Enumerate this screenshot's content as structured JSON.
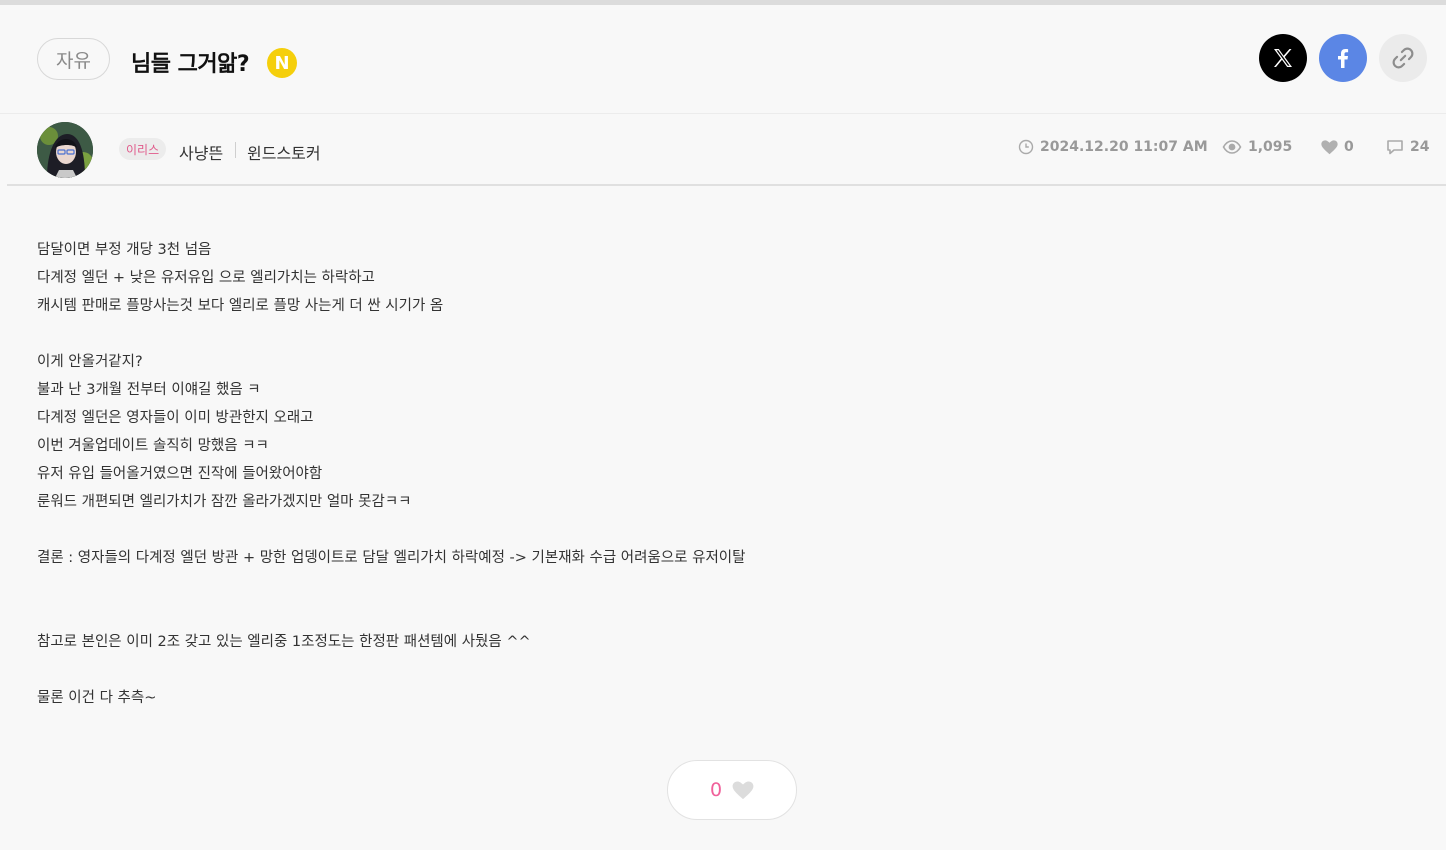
{
  "post": {
    "category": "자유",
    "title": "님들 그거앎?",
    "new_badge": "N"
  },
  "share": {
    "x_icon": "x-logo-icon",
    "facebook_icon": "facebook-icon",
    "link_icon": "link-icon"
  },
  "author": {
    "server": "이리스",
    "nickname": "사냥뜬",
    "job": "윈드스토커"
  },
  "stats": {
    "datetime": "2024.12.20 11:07 AM",
    "views": "1,095",
    "likes": "0",
    "comments": "24"
  },
  "content": {
    "lines": [
      "담달이면 부정 개당 3천 넘음",
      "다계정 엘던 + 낮은 유저유입 으로 엘리가치는 하락하고",
      "캐시템 판매로 플망사는것 보다 엘리로 플망 사는게 더 싼 시기가 옴",
      "",
      "이게 안올거같지?",
      "불과 난 3개월 전부터 이얘길 했음 ㅋ",
      "다계정 엘던은 영자들이 이미 방관한지 오래고",
      "이번 겨울업데이트 솔직히 망했음 ㅋㅋ",
      "유저 유입 들어올거였으면 진작에 들어왔어야함",
      "룬워드 개편되면 엘리가치가 잠깐 올라가겠지만 얼마 못감ㅋㅋ",
      "",
      "결론 : 영자들의 다계정 엘던 방관 + 망한 업뎅이트로 담달 엘리가치 하락예정 -> 기본재화 수급 어려움으로 유저이탈",
      "",
      "",
      "참고로 본인은 이미 2조 갖고 있는 엘리중 1조정도는 한정판 패션템에 사뒀음 ^^",
      "",
      "물론 이건 다 추측~"
    ]
  },
  "like_button": {
    "count": "0"
  },
  "colors": {
    "accent_pink": "#f0609a",
    "new_badge": "#f5cf0c",
    "facebook": "#5b86e5"
  }
}
